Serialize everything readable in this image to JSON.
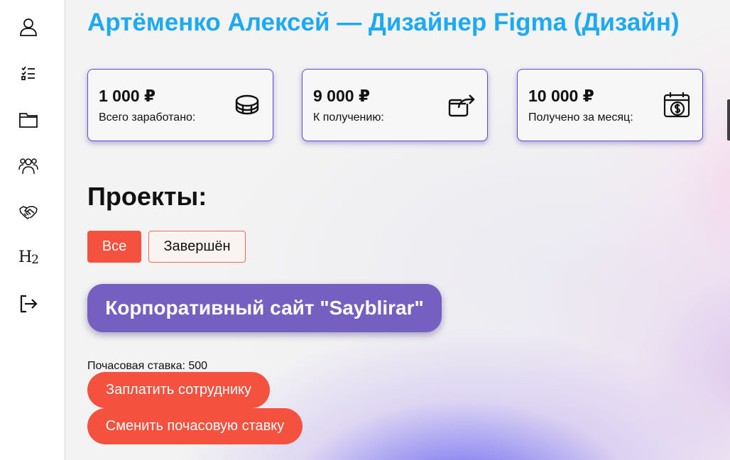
{
  "header": {
    "title": "Артёменко Алексей — Дизайнер Figma (Дизайн)"
  },
  "sidebar": {
    "items": [
      {
        "icon": "user-icon"
      },
      {
        "icon": "task-list-icon"
      },
      {
        "icon": "folder-icon"
      },
      {
        "icon": "team-icon"
      },
      {
        "icon": "handshake-icon"
      },
      {
        "icon": "h2-icon",
        "text": "H",
        "sub": "2"
      },
      {
        "icon": "logout-icon"
      }
    ]
  },
  "stats": [
    {
      "amount": "1 000 ₽",
      "label": "Всего заработано:",
      "icon": "coins-icon"
    },
    {
      "amount": "9 000 ₽",
      "label": "К получению:",
      "icon": "wallet-arrow-icon"
    },
    {
      "amount": "10 000 ₽",
      "label": "Получено за месяц:",
      "icon": "calendar-dollar-icon"
    }
  ],
  "projects": {
    "heading": "Проекты:",
    "filters": [
      {
        "label": "Все",
        "active": true
      },
      {
        "label": "Завершён",
        "active": false
      }
    ],
    "items": [
      {
        "name": "Корпоративный сайт \"Sayblirar\"",
        "rate_text": "Почасовая ставка: 500",
        "pay_label": "Заплатить сотруднику",
        "change_rate_label": "Сменить почасовую ставку"
      }
    ]
  },
  "colors": {
    "title": "#1eaaf2",
    "accent": "#f4523f",
    "project": "#7560c1",
    "card_border": "#5b4bd6"
  }
}
